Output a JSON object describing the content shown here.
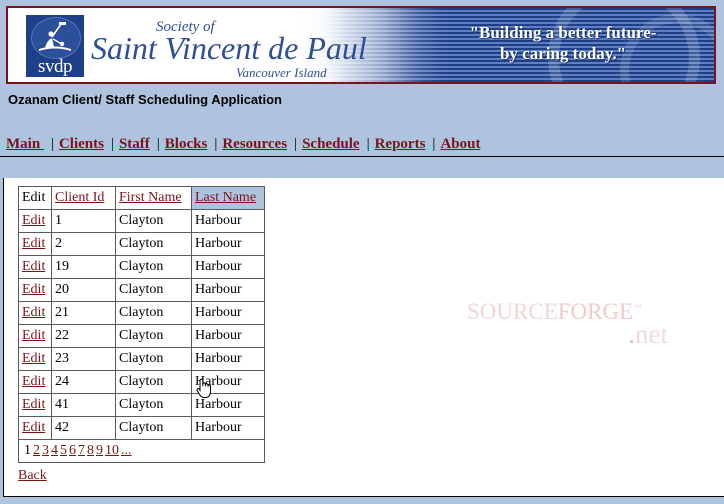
{
  "banner": {
    "logo_word": "svdp",
    "society_of": "Society of",
    "org_name": "Saint Vincent de Paul",
    "region": "Vancouver Island",
    "slogan_line1": "\"Building a better future-",
    "slogan_line2": "by caring today.\"",
    "border_color": "#7b1418",
    "text_color": "#2e4f96"
  },
  "app_title": "Ozanam Client/ Staff Scheduling Application",
  "nav": {
    "separator": "|",
    "items": [
      {
        "label": "Main "
      },
      {
        "label": "Clients"
      },
      {
        "label": "Staff"
      },
      {
        "label": "Blocks"
      },
      {
        "label": "Resources"
      },
      {
        "label": "Schedule"
      },
      {
        "label": "Reports"
      },
      {
        "label": "About"
      }
    ],
    "link_color": "#7b1418"
  },
  "table": {
    "headers": [
      {
        "label": "Edit",
        "is_link": false,
        "selected": false
      },
      {
        "label": "Client Id",
        "is_link": true,
        "selected": false
      },
      {
        "label": "First Name",
        "is_link": true,
        "selected": false
      },
      {
        "label": "Last Name",
        "is_link": true,
        "selected": true
      }
    ],
    "edit_label": "Edit",
    "rows": [
      {
        "edit": "Edit",
        "client_id": "1",
        "first_name": "Clayton",
        "last_name": "Harbour"
      },
      {
        "edit": "Edit",
        "client_id": "2",
        "first_name": "Clayton",
        "last_name": "Harbour"
      },
      {
        "edit": "Edit",
        "client_id": "19",
        "first_name": "Clayton",
        "last_name": "Harbour"
      },
      {
        "edit": "Edit",
        "client_id": "20",
        "first_name": "Clayton",
        "last_name": "Harbour"
      },
      {
        "edit": "Edit",
        "client_id": "21",
        "first_name": "Clayton",
        "last_name": "Harbour"
      },
      {
        "edit": "Edit",
        "client_id": "22",
        "first_name": "Clayton",
        "last_name": "Harbour"
      },
      {
        "edit": "Edit",
        "client_id": "23",
        "first_name": "Clayton",
        "last_name": "Harbour"
      },
      {
        "edit": "Edit",
        "client_id": "24",
        "first_name": "Clayton",
        "last_name": "Harbour"
      },
      {
        "edit": "Edit",
        "client_id": "41",
        "first_name": "Clayton",
        "last_name": "Harbour"
      },
      {
        "edit": "Edit",
        "client_id": "42",
        "first_name": "Clayton",
        "last_name": "Harbour"
      }
    ],
    "selection_color": "#aec4de"
  },
  "pager": {
    "current_page": "1",
    "pages": [
      "2",
      "3",
      "4",
      "5",
      "6",
      "7",
      "8",
      "9",
      "10"
    ],
    "more": "..."
  },
  "back_label": "Back",
  "watermark": {
    "line1_a": "SOURCE",
    "line1_b": "FORGE",
    "tm": "™",
    "dot": ".",
    "line2": "net"
  },
  "cursor": {
    "icon": "hand-pointer-cursor"
  },
  "colors": {
    "page_background": "#aec4de",
    "content_background": "#ffffff",
    "link": "#7b1418",
    "banner_blue": "#1d4089"
  }
}
